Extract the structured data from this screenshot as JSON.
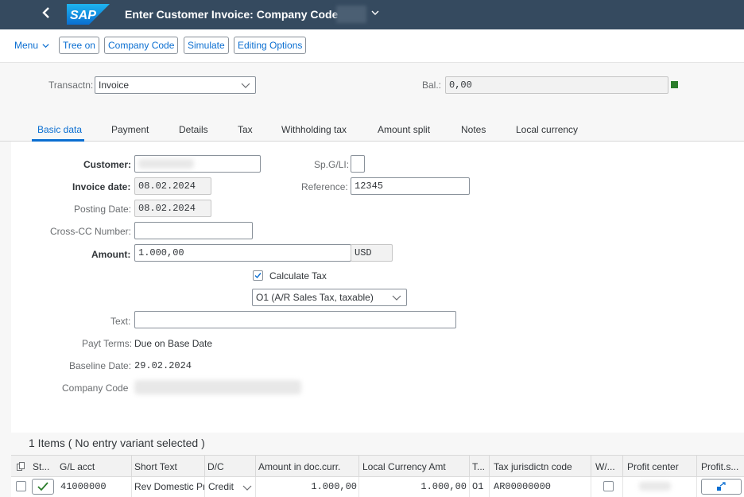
{
  "shell": {
    "back_icon": "back-arrow-icon",
    "logo_text": "SAP",
    "title": "Enter Customer Invoice: Company Code",
    "title_dropdown_icon": "chevron-down-icon"
  },
  "toolbar": {
    "menu_label": "Menu",
    "buttons": [
      "Tree on",
      "Company Code",
      "Simulate",
      "Editing Options"
    ]
  },
  "header": {
    "transaction_label": "Transactn:",
    "transaction_value": "Invoice",
    "balance_label": "Bal.:",
    "balance_value": "0,00",
    "balance_status_color": "#2b7d2b"
  },
  "tabs": [
    "Basic data",
    "Payment",
    "Details",
    "Tax",
    "Withholding tax",
    "Amount split",
    "Notes",
    "Local currency"
  ],
  "form": {
    "customer_label": "Customer:",
    "customer_value": "",
    "spgl_label": "Sp.G/LI:",
    "spgl_value": "",
    "invoice_date_label": "Invoice date:",
    "invoice_date_value": "08.02.2024",
    "reference_label": "Reference:",
    "reference_value": "12345",
    "posting_date_label": "Posting Date:",
    "posting_date_value": "08.02.2024",
    "cross_cc_label": "Cross-CC Number:",
    "cross_cc_value": "",
    "amount_label": "Amount:",
    "amount_value": "1.000,00",
    "currency_value": "USD",
    "calculate_tax_label": "Calculate Tax",
    "calculate_tax_checked": true,
    "tax_code_value": "O1 (A/R Sales Tax, taxable)",
    "text_label": "Text:",
    "text_value": "",
    "payt_terms_label": "Payt Terms:",
    "payt_terms_value": "Due on Base Date",
    "baseline_date_label": "Baseline Date:",
    "baseline_date_value": "29.02.2024",
    "company_code_label": "Company Code",
    "company_code_value": ""
  },
  "items": {
    "title": "1 Items ( No entry variant selected )",
    "columns": [
      "St...",
      "G/L acct",
      "Short Text",
      "D/C",
      "Amount in doc.curr.",
      "Local Currency Amt",
      "T...",
      "Tax jurisdictn code",
      "W/...",
      "Profit center",
      "Profit.s..."
    ],
    "rows": [
      {
        "status_icon": "checkmark-icon",
        "gl_acct": "41000000",
        "short_text": "Rev Domestic Pr",
        "dc": "Credit",
        "amount_doc": "1.000,00",
        "amount_local": "1.000,00",
        "tax_code": "O1",
        "tax_jurisdiction": "AR00000000",
        "profit_center": "",
        "profit_segment_icon": "navigate-arrow-icon"
      }
    ]
  }
}
